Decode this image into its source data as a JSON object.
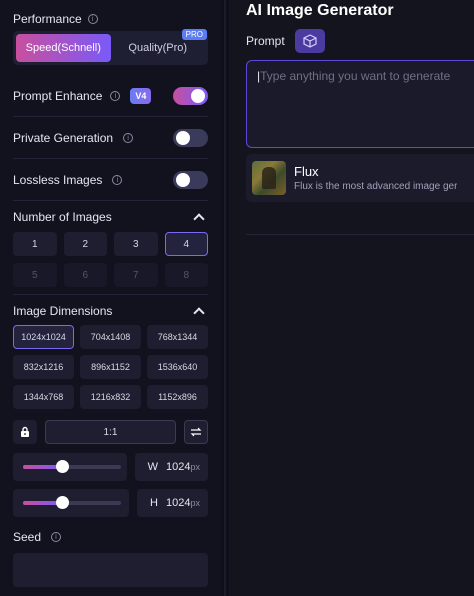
{
  "sidebar": {
    "performance_label": "Performance",
    "modes": [
      {
        "label": "Speed(Schnell)",
        "active": true
      },
      {
        "label": "Quality(Pro)",
        "active": false,
        "badge": "PRO"
      }
    ],
    "prompt_enhance": {
      "label": "Prompt Enhance",
      "badge": "V4",
      "on": true
    },
    "private_generation": {
      "label": "Private Generation",
      "on": false
    },
    "lossless_images": {
      "label": "Lossless Images",
      "on": false
    },
    "number_of_images": {
      "label": "Number of Images",
      "options": [
        "1",
        "2",
        "3",
        "4",
        "5",
        "6",
        "7",
        "8"
      ],
      "selected": "4",
      "enabled_count": 4
    },
    "image_dimensions": {
      "label": "Image Dimensions",
      "options": [
        "1024x1024",
        "704x1408",
        "768x1344",
        "832x1216",
        "896x1152",
        "1536x640",
        "1344x768",
        "1216x832",
        "1152x896"
      ],
      "selected": "1024x1024",
      "aspect_ratio": "1:1",
      "width_label": "W",
      "width_value": "1024",
      "height_label": "H",
      "height_value": "1024",
      "unit": "px",
      "width_slider": 0.4,
      "height_slider": 0.4
    },
    "seed_label": "Seed"
  },
  "main": {
    "title": "AI Image Generator",
    "prompt_label": "Prompt",
    "prompt_placeholder": "Type anything you want to generate",
    "model": {
      "name": "Flux",
      "description": "Flux is the most advanced image ger"
    }
  },
  "colors": {
    "accent_gradient_start": "#c84f9e",
    "accent_gradient_end": "#7a5af8",
    "background": "#12121f"
  }
}
